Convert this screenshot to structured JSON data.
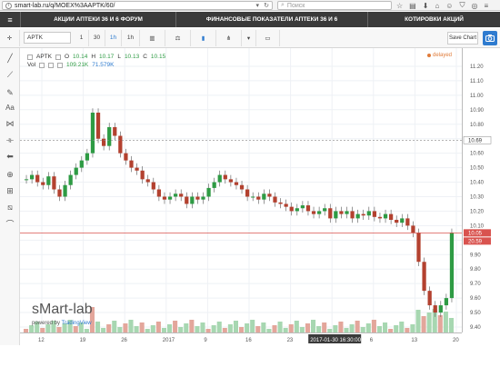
{
  "browser": {
    "url": "smart-lab.ru/q/MOEX%3AAPTK/60/",
    "search_placeholder": "Поиск"
  },
  "nav": {
    "items": [
      "АКЦИИ АПТЕКИ 36 И 6 ФОРУМ",
      "ФИНАНСОВЫЕ ПОКАЗАТЕЛИ АПТЕКИ 36 И 6",
      "КОТИРОВКИ АКЦИЙ"
    ]
  },
  "toolbar": {
    "symbol": "APTK",
    "intervals": [
      "1",
      "30",
      "1h",
      "1h"
    ],
    "save_label": "Save Chart"
  },
  "legend": {
    "symbol": "APTK",
    "ohlc": {
      "o_label": "O",
      "o": "10.14",
      "h_label": "H",
      "h": "10.17",
      "l_label": "L",
      "l": "10.13",
      "c_label": "C",
      "c": "10.15"
    },
    "vol_label": "Vol",
    "vol_value": "109.21K",
    "vol_ma": "71.579K",
    "delayed": "delayed"
  },
  "price_axis": {
    "ticks": [
      "11.20",
      "11.10",
      "11.00",
      "10.90",
      "10.80",
      "10.70",
      "10.60",
      "10.50",
      "10.40",
      "10.30",
      "10.20",
      "10.10",
      "10.00",
      "9.90",
      "9.80",
      "9.70",
      "9.60",
      "9.50",
      "9.40"
    ],
    "crosshair_price": "10.69",
    "last_price": "10.05",
    "last_badge": "20.59"
  },
  "time_axis": {
    "ticks": [
      "12",
      "19",
      "26",
      "2017",
      "9",
      "16",
      "23",
      "2017-01-30 16:30:00",
      "6",
      "13",
      "20"
    ]
  },
  "branding": {
    "watermark": "sMart-lab",
    "powered_by": "powered by",
    "tradingview": "TradingView"
  },
  "colors": {
    "up": "#2e9b44",
    "down": "#b3412f",
    "accent": "#2e7bcf",
    "navbar": "#3a3a3a"
  },
  "chart_data": {
    "type": "candlestick",
    "symbol": "APTK",
    "ylim": [
      9.4,
      11.25
    ],
    "close": [
      10.42,
      10.45,
      10.4,
      10.38,
      10.44,
      10.35,
      10.3,
      10.38,
      10.45,
      10.5,
      10.55,
      10.6,
      10.88,
      10.7,
      10.65,
      10.78,
      10.72,
      10.6,
      10.55,
      10.5,
      10.48,
      10.42,
      10.4,
      10.35,
      10.3,
      10.28,
      10.3,
      10.32,
      10.3,
      10.25,
      10.3,
      10.28,
      10.3,
      10.36,
      10.4,
      10.45,
      10.42,
      10.4,
      10.38,
      10.35,
      10.3,
      10.3,
      10.28,
      10.32,
      10.3,
      10.26,
      10.25,
      10.23,
      10.2,
      10.22,
      10.24,
      10.2,
      10.18,
      10.2,
      10.22,
      10.15,
      10.2,
      10.18,
      10.2,
      10.15,
      10.18,
      10.17,
      10.2,
      10.16,
      10.15,
      10.18,
      10.14,
      10.12,
      10.15,
      10.1,
      10.05,
      9.85,
      9.65,
      9.55,
      9.5,
      9.55,
      9.6,
      10.05
    ]
  }
}
